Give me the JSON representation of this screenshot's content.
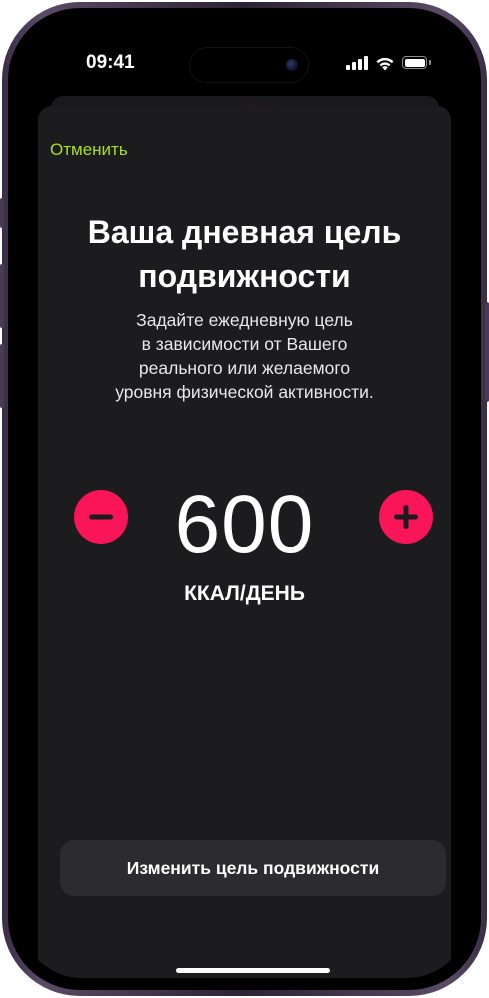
{
  "status_bar": {
    "time": "09:41",
    "icons": [
      "cellular-signal-icon",
      "wifi-icon",
      "battery-icon"
    ]
  },
  "sheet": {
    "cancel_label": "Отменить",
    "title_lines": [
      "Ваша дневная цель",
      "подвижности"
    ],
    "description_lines": [
      "Задайте ежедневную цель",
      "в зависимости от Вашего",
      "реального или желаемого",
      "уровня физической активности."
    ],
    "goal_value": "600",
    "goal_unit": "ККАЛ/ДЕНЬ",
    "decrease_icon": "minus-icon",
    "increase_icon": "plus-icon",
    "change_goal_label": "Изменить цель подвижности"
  },
  "colors": {
    "accent_green": "#a8e01a",
    "move_red": "#fa1458",
    "sheet_background": "#1c1c1e",
    "button_background": "#2c2c2e"
  }
}
